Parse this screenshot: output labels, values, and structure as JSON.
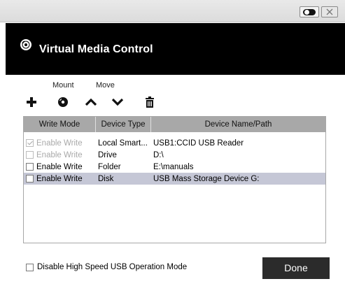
{
  "window": {
    "title": "Virtual Media Control",
    "controls": {
      "toggle": "toggle-icon",
      "close": "close-icon"
    }
  },
  "toolbar": {
    "mount_label": "Mount",
    "move_label": "Move",
    "buttons": [
      "add-icon",
      "disc-icon",
      "chevron-up-icon",
      "chevron-down-icon",
      "trash-icon"
    ]
  },
  "table": {
    "columns": [
      "Write Mode",
      "Device Type",
      "Device Name/Path"
    ],
    "rows": [
      {
        "mode": "Enable Write",
        "checked": true,
        "enabled": false,
        "type": "Local Smart...",
        "path": "USB1:CCID USB Reader",
        "selected": false
      },
      {
        "mode": "Enable Write",
        "checked": false,
        "enabled": false,
        "type": "Drive",
        "path": "D:\\",
        "selected": false
      },
      {
        "mode": "Enable Write",
        "checked": false,
        "enabled": true,
        "type": "Folder",
        "path": "E:\\manuals",
        "selected": false
      },
      {
        "mode": "Enable Write",
        "checked": false,
        "enabled": true,
        "type": "Disk",
        "path": "USB Mass Storage Device G:",
        "selected": true
      }
    ]
  },
  "footer": {
    "high_speed_label": "Disable High Speed USB Operation Mode",
    "high_speed_checked": false,
    "done_label": "Done"
  },
  "colors": {
    "header_bg": "#000000",
    "table_header_bg": "#a8a8a8",
    "selected_row_bg": "#c5c7d6",
    "done_bg": "#2b2b2b"
  }
}
